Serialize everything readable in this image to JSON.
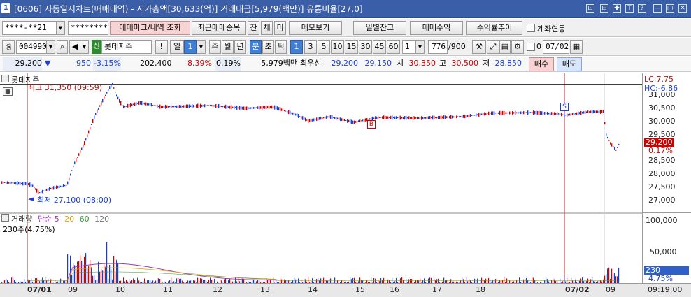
{
  "window": {
    "number": "1",
    "title": "[0606] 자동일지차트(매매내역) - 시가총액[30,633(억)] 거래대금[5,979(백만)] 유통비율[27.0]",
    "controls": [
      "⊡",
      "⊟",
      "✚",
      "T",
      "?",
      "—",
      "□",
      "✕"
    ]
  },
  "toolbar1": {
    "account": "****-**21",
    "password": "********",
    "trade_mark_btn": "매매마크/내역 조회",
    "recent_btn": "최근매매종목",
    "jan_btn": "잔",
    "che_btn": "체",
    "mi_btn": "미",
    "memo_btn": "메모보기",
    "daily_balance_btn": "일별잔고",
    "trade_profit_btn": "매매수익",
    "return_trend_btn": "수익률추이",
    "account_link_label": "계좌연동"
  },
  "toolbar2": {
    "code": "004990",
    "sin_badge": "신",
    "name": "롯데지주",
    "excl": "!",
    "period_il": "일",
    "period_value": "1",
    "periods": [
      "주",
      "월",
      "년"
    ],
    "minute": "분",
    "cho": "초",
    "tick": "틱",
    "intervals": [
      "1",
      "3",
      "5",
      "10",
      "15",
      "30",
      "45",
      "60"
    ],
    "interval_sel": "1",
    "count": "776",
    "count_total": "/900",
    "zero_label": "0",
    "date": "07/02"
  },
  "quote": {
    "price": "29,200",
    "arrow": "▼",
    "change": "950",
    "change_pct": "-3.15%",
    "volume": "202,400",
    "turnover_pct": "8.39%",
    "ratio": "0.19%",
    "amount": "5,979백만",
    "best_label": "최우선",
    "ask": "29,200",
    "bid": "29,150",
    "open_label": "시",
    "open": "30,350",
    "high_label": "고",
    "high": "30,500",
    "low_label": "저",
    "low": "28,850",
    "buy_btn": "매수",
    "sell_btn": "매도"
  },
  "price_pane": {
    "name": "롯데지주",
    "high_note": "최고 31,350 (09:59)",
    "low_note": "최저 27,100 (08:00)",
    "marker_b": "B",
    "marker_s": "S",
    "lc": "LC:7.75",
    "hc": "HC:-6.86",
    "y_ticks": [
      "31,000",
      "30,500",
      "30,000",
      "29,500",
      "29,000",
      "28,500",
      "28,000",
      "27,500",
      "27,000"
    ],
    "current_price": "29,200",
    "current_pct": "0.17%"
  },
  "volume_pane": {
    "title": "거래량",
    "ma_label": "단순",
    "ma5": "5",
    "ma20": "20",
    "ma60": "60",
    "ma120": "120",
    "unit_note": "230주(4.75%)",
    "y_ticks": [
      "100,000",
      "50,000"
    ],
    "current_vol": "230",
    "current_pct": "4.75%"
  },
  "x_axis": {
    "labels": [
      "07/01",
      "09",
      "10",
      "11",
      "12",
      "13",
      "14",
      "15",
      "16",
      "17",
      "18",
      "07/02",
      "09"
    ],
    "time": "09:19:00"
  },
  "colors": {
    "title_bg": "#3b5ea8",
    "up": "#d00000",
    "down": "#1a3fd0",
    "vline": "#b03030"
  }
}
